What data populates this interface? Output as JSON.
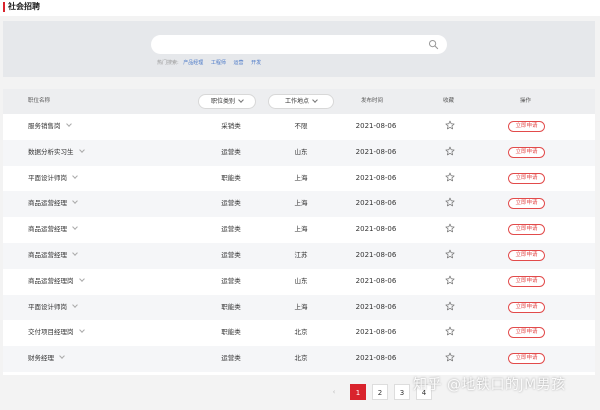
{
  "header": {
    "title": "社会招聘"
  },
  "search": {
    "value": "",
    "placeholder": "",
    "hot_label": "热门搜索:",
    "hot_keywords": [
      "产品经理",
      "工程师",
      "运营",
      "开发"
    ]
  },
  "table": {
    "columns": {
      "name": "职位名称",
      "type": "职位类别",
      "location": "工作地点",
      "date": "发布时间",
      "favorite": "收藏",
      "action": "操作"
    },
    "apply_label": "立即申请",
    "rows": [
      {
        "name": "服务销售岗",
        "type": "采销类",
        "location": "不限",
        "date": "2021-08-06"
      },
      {
        "name": "数据分析实习生",
        "type": "运营类",
        "location": "山东",
        "date": "2021-08-06"
      },
      {
        "name": "平面设计师岗",
        "type": "职能类",
        "location": "上海",
        "date": "2021-08-06"
      },
      {
        "name": "商品运营经理",
        "type": "运营类",
        "location": "上海",
        "date": "2021-08-06"
      },
      {
        "name": "商品运营经理",
        "type": "运营类",
        "location": "上海",
        "date": "2021-08-06"
      },
      {
        "name": "商品运营经理",
        "type": "运营类",
        "location": "江苏",
        "date": "2021-08-06"
      },
      {
        "name": "商品运营经理岗",
        "type": "运营类",
        "location": "山东",
        "date": "2021-08-06"
      },
      {
        "name": "平面设计师岗",
        "type": "职能类",
        "location": "上海",
        "date": "2021-08-06"
      },
      {
        "name": "交付项目经理岗",
        "type": "职能类",
        "location": "北京",
        "date": "2021-08-06"
      },
      {
        "name": "财务经理",
        "type": "运营类",
        "location": "北京",
        "date": "2021-08-06"
      }
    ]
  },
  "pagination": {
    "pages": [
      "1",
      "2",
      "3",
      "4"
    ],
    "current": "1"
  },
  "watermark": "知乎 @地铁口的JM男孩",
  "colors": {
    "accent": "#d9232c",
    "link": "#4a78c7",
    "apply": "#e24b4b"
  }
}
